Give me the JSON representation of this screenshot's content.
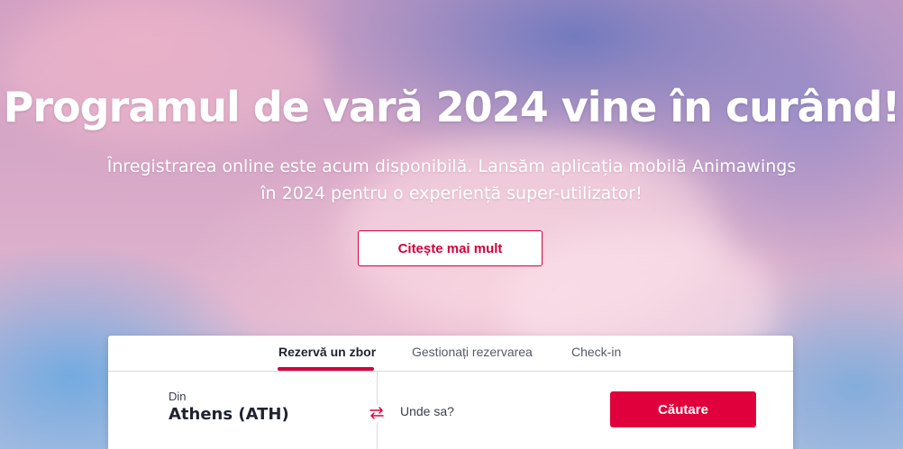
{
  "hero": {
    "headline": "Programul de vară 2024 vine în curând!",
    "subtitle_line1": "Înregistrarea online este acum disponibilă. Lansăm aplicația mobilă Animawings",
    "subtitle_line2": "în 2024 pentru o experiență super-utilizator!",
    "read_more_label": "Citește mai mult"
  },
  "booking": {
    "tabs": [
      {
        "label": "Rezervă un zbor",
        "active": true
      },
      {
        "label": "Gestionați rezervarea",
        "active": false
      },
      {
        "label": "Check-in",
        "active": false
      }
    ],
    "origin_label": "Din",
    "origin_value": "Athens (ATH)",
    "destination_placeholder": "Unde sa?",
    "search_label": "Căutare",
    "swap_icon": "swap-arrows-icon"
  },
  "colors": {
    "accent": "#e0003c",
    "text_dark": "#1f2330"
  }
}
